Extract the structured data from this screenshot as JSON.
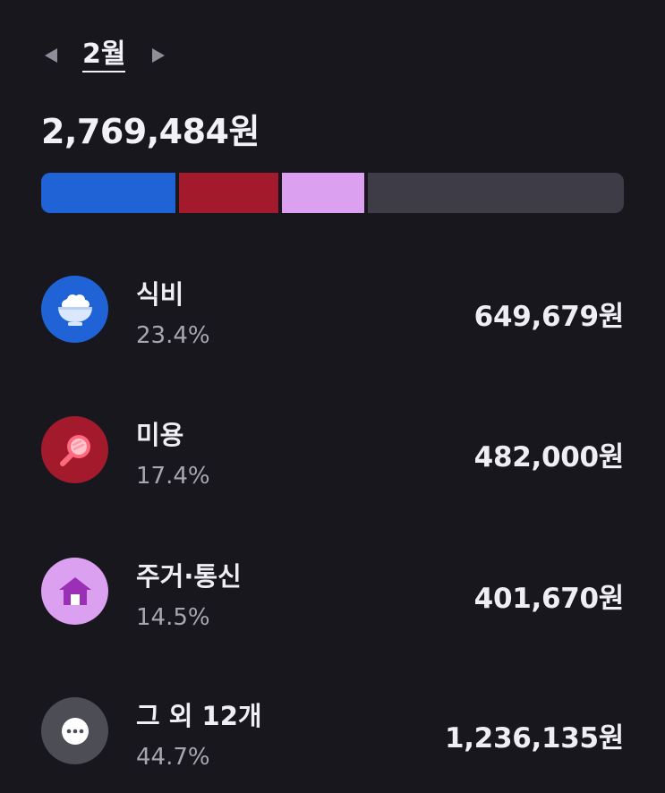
{
  "month_nav": {
    "prev_icon": "triangle-left-icon",
    "label": "2월",
    "next_icon": "triangle-right-icon"
  },
  "total_amount": "2,769,484원",
  "ratio_bar": {
    "segments": [
      {
        "name": "식비",
        "ratio": 0.234,
        "color": "#1f63d6"
      },
      {
        "name": "미용",
        "ratio": 0.174,
        "color": "#a21a2c"
      },
      {
        "name": "주거·통신",
        "ratio": 0.145,
        "color": "#dba0ef"
      },
      {
        "name": "그 외 12개",
        "ratio": 0.447,
        "color": "#3d3c47"
      }
    ]
  },
  "categories": [
    {
      "name": "식비",
      "percent": "23.4%",
      "amount": "649,679원",
      "icon": "rice-bowl-icon",
      "color": "#1f63d6"
    },
    {
      "name": "미용",
      "percent": "17.4%",
      "amount": "482,000원",
      "icon": "hand-mirror-icon",
      "color": "#a21a2c"
    },
    {
      "name": "주거·통신",
      "percent": "14.5%",
      "amount": "401,670원",
      "icon": "house-icon",
      "color": "#dba0ef"
    },
    {
      "name": "그 외 12개",
      "percent": "44.7%",
      "amount": "1,236,135원",
      "icon": "more-dots-icon",
      "color": "#4d4e55"
    }
  ]
}
